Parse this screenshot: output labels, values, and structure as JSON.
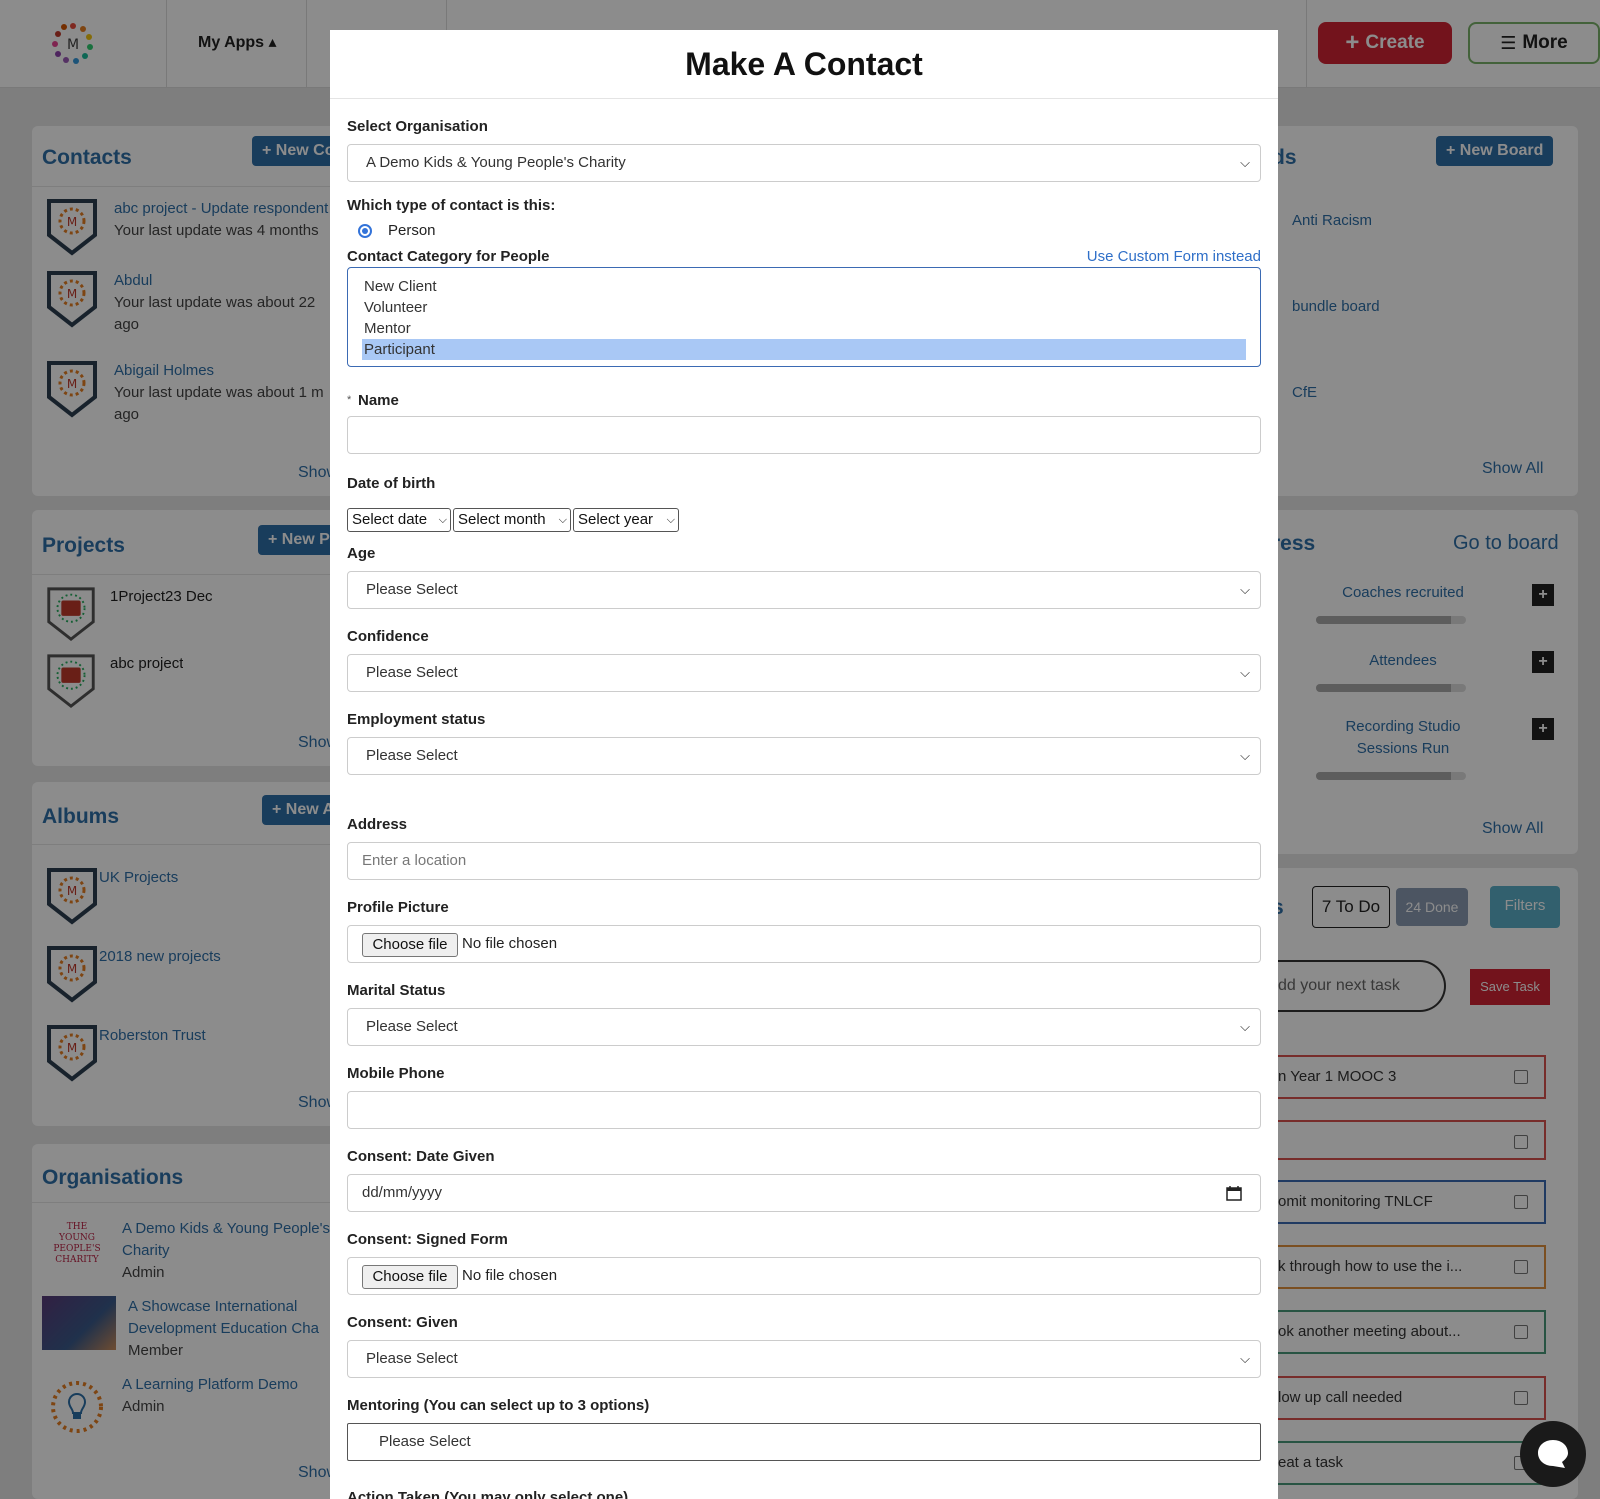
{
  "topbar": {
    "my_apps": "My Apps ▴",
    "create_label": "Create",
    "more_label": "More",
    "partial_text": "n"
  },
  "contacts": {
    "title": "Contacts",
    "new_btn": "+ New Co",
    "items": [
      {
        "name": "abc project - Update respondent",
        "line1": "Your last update was 4 months",
        "line2": ""
      },
      {
        "name": "Abdul",
        "line1": "Your last update was about 22",
        "line2": "ago"
      },
      {
        "name": "Abigail Holmes",
        "line1": "Your last update was about 1 m",
        "line2": "ago"
      }
    ],
    "show": "Show"
  },
  "projects": {
    "title": "Projects",
    "new_btn": "+ New P",
    "items": [
      "1Project23 Dec",
      "abc project"
    ],
    "show": "Show"
  },
  "albums": {
    "title": "Albums",
    "new_btn": "+ New A",
    "items": [
      "UK Projects",
      "2018 new projects",
      "Roberston Trust"
    ],
    "show": "Show"
  },
  "organisations": {
    "title": "Organisations",
    "items": [
      {
        "name1": "A Demo Kids & Young People's",
        "name2": "Charity",
        "role": "Admin",
        "logo_text": "THE YOUNG PEOPLE'S CHARITY"
      },
      {
        "name1": "A Showcase International",
        "name2": "Development Education Cha",
        "role": "Member"
      },
      {
        "name1": "A Learning Platform Demo",
        "name2": "",
        "role": "Admin"
      }
    ],
    "show": "Show"
  },
  "boards": {
    "title_partial": "ds",
    "new_btn": "+ New Board",
    "items": [
      "Anti Racism",
      "bundle board",
      "CfE"
    ],
    "show_all": "Show All"
  },
  "progress": {
    "title_partial": "ress",
    "go_to_board": "Go to board",
    "items": [
      {
        "label1": "Coaches recruited",
        "label2": "",
        "fill": 0.9
      },
      {
        "label1": "Attendees",
        "label2": "",
        "fill": 0.9
      },
      {
        "label1": "Recording Studio",
        "label2": "Sessions Run",
        "fill": 0.9
      }
    ],
    "show_all": "Show All"
  },
  "tasks": {
    "title_partial": "s",
    "todo": "7 To Do",
    "done": "24 Done",
    "filters": "Filters",
    "placeholder": "dd your next task",
    "save": "Save Task",
    "rows": [
      {
        "text": "n Year 1 MOOC 3",
        "color": "#d9534f"
      },
      {
        "text": "",
        "color": "#d9534f"
      },
      {
        "text": "omit monitoring TNLCF",
        "color": "#3b6ab3"
      },
      {
        "text": "k through how to use the i...",
        "color": "#e0913c"
      },
      {
        "text": "ok another meeting about...",
        "color": "#4a9a7a"
      },
      {
        "text": "low up call needed",
        "color": "#d9534f"
      },
      {
        "text": "eat a task",
        "color": "#4a9a7a"
      }
    ]
  },
  "modal": {
    "title": "Make A Contact",
    "org_label": "Select Organisation",
    "org_value": "A Demo Kids & Young People's Charity",
    "contact_type_label": "Which type of contact is this:",
    "contact_type_value": "Person",
    "category_label": "Contact Category for People",
    "custom_form_link": "Use Custom Form instead",
    "category_options": [
      "New Client",
      "Volunteer",
      "Mentor",
      "Participant"
    ],
    "category_selected": "Participant",
    "required_mark": "*",
    "name_label": "Name",
    "name_value": "",
    "dob_label": "Date of birth",
    "dob_date": "Select date",
    "dob_month": "Select month",
    "dob_year": "Select year",
    "age_label": "Age",
    "age_value": "Please Select",
    "confidence_label": "Confidence",
    "confidence_value": "Please Select",
    "employment_label": "Employment status",
    "employment_value": "Please Select",
    "address_label": "Address",
    "address_placeholder": "Enter a location",
    "profile_label": "Profile Picture",
    "choose_file": "Choose file",
    "no_file": "No file chosen",
    "marital_label": "Marital Status",
    "marital_value": "Please Select",
    "mobile_label": "Mobile Phone",
    "mobile_value": "",
    "consent_date_label": "Consent: Date Given",
    "consent_date_placeholder": "dd/mm/yyyy",
    "consent_form_label": "Consent: Signed Form",
    "consent_given_label": "Consent: Given",
    "consent_given_value": "Please Select",
    "mentoring_label": "Mentoring (You can select up to 3 options)",
    "mentoring_value": "Please Select",
    "action_label": "Action Taken (You may only select one)"
  }
}
